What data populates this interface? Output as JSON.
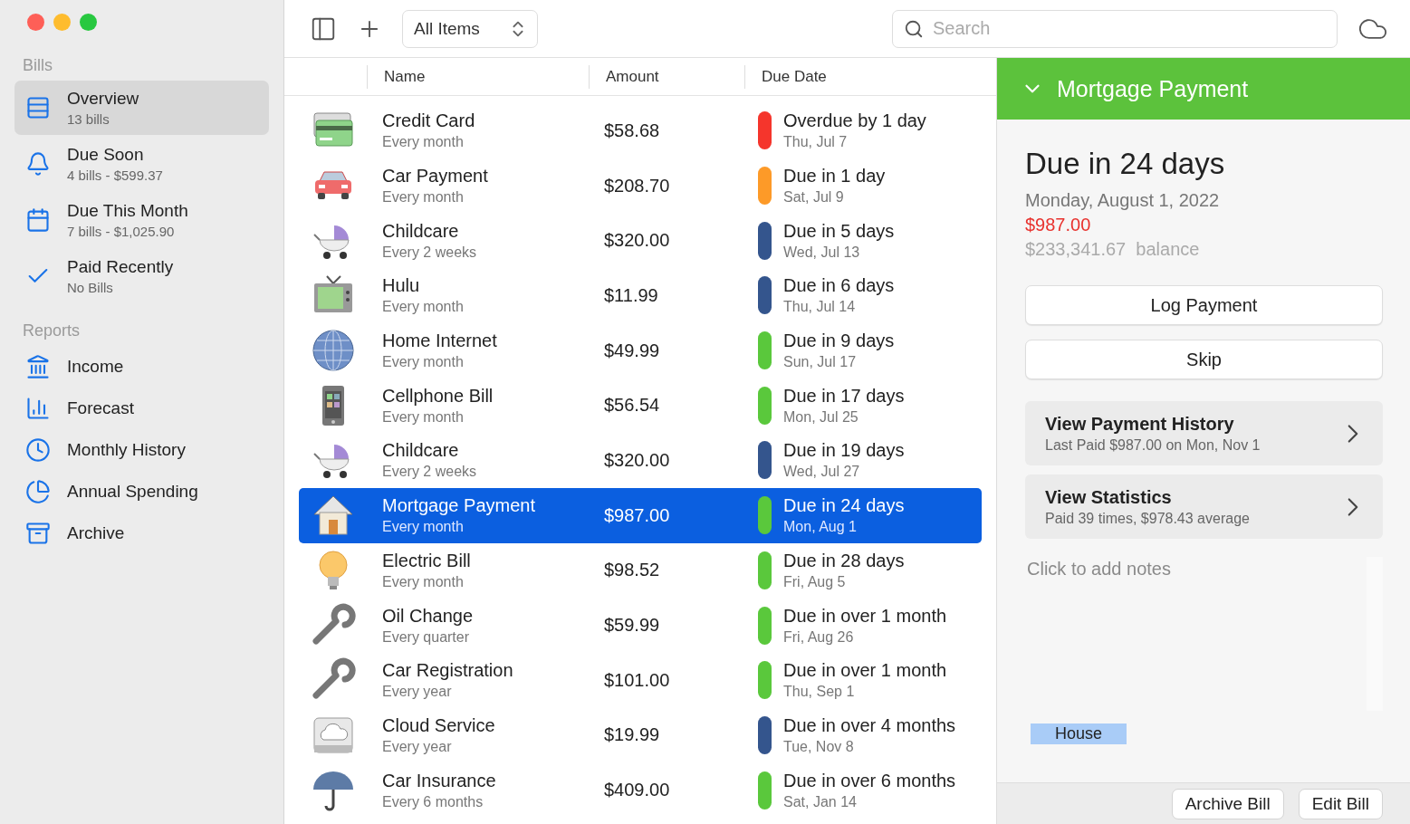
{
  "sidebar": {
    "sections": [
      {
        "title": "Bills",
        "items": [
          {
            "label": "Overview",
            "detail": "13 bills",
            "kind": "list",
            "selected": true
          },
          {
            "label": "Due Soon",
            "detail": "4 bills - $599.37",
            "kind": "bell",
            "selected": false
          },
          {
            "label": "Due This Month",
            "detail": "7 bills - $1,025.90",
            "kind": "calendar",
            "selected": false
          },
          {
            "label": "Paid Recently",
            "detail": "No Bills",
            "kind": "check",
            "selected": false
          }
        ]
      },
      {
        "title": "Reports",
        "items": [
          {
            "label": "Income",
            "kind": "bank",
            "selected": false
          },
          {
            "label": "Forecast",
            "kind": "chart",
            "selected": false
          },
          {
            "label": "Monthly History",
            "kind": "clock",
            "selected": false
          },
          {
            "label": "Annual Spending",
            "kind": "pie",
            "selected": false
          },
          {
            "label": "Archive",
            "kind": "archive",
            "selected": false
          }
        ]
      }
    ]
  },
  "toolbar": {
    "filter": "All Items",
    "search": {
      "placeholder": "Search"
    }
  },
  "table": {
    "columns": [
      "Name",
      "Amount",
      "Due Date"
    ],
    "rows": [
      {
        "name": "Credit Card",
        "frequency": "Every month",
        "amount": "$58.68",
        "due": "Overdue by 1 day",
        "date": "Thu, Jul 7",
        "color": "#f5352c",
        "kind": "card",
        "selected": false
      },
      {
        "name": "Car Payment",
        "frequency": "Every month",
        "amount": "$208.70",
        "due": "Due in 1 day",
        "date": "Sat, Jul 9",
        "color": "#fd9a28",
        "kind": "car",
        "selected": false
      },
      {
        "name": "Childcare",
        "frequency": "Every 2 weeks",
        "amount": "$320.00",
        "due": "Due in 5 days",
        "date": "Wed, Jul 13",
        "color": "#34558d",
        "kind": "stroller",
        "selected": false
      },
      {
        "name": "Hulu",
        "frequency": "Every month",
        "amount": "$11.99",
        "due": "Due in 6 days",
        "date": "Thu, Jul 14",
        "color": "#34558d",
        "kind": "tv",
        "selected": false
      },
      {
        "name": "Home Internet",
        "frequency": "Every month",
        "amount": "$49.99",
        "due": "Due in 9 days",
        "date": "Sun, Jul 17",
        "color": "#5ac83c",
        "kind": "globe",
        "selected": false
      },
      {
        "name": "Cellphone Bill",
        "frequency": "Every month",
        "amount": "$56.54",
        "due": "Due in 17 days",
        "date": "Mon, Jul 25",
        "color": "#5ac83c",
        "kind": "phone",
        "selected": false
      },
      {
        "name": "Childcare",
        "frequency": "Every 2 weeks",
        "amount": "$320.00",
        "due": "Due in 19 days",
        "date": "Wed, Jul 27",
        "color": "#34558d",
        "kind": "stroller",
        "selected": false
      },
      {
        "name": "Mortgage Payment",
        "frequency": "Every month",
        "amount": "$987.00",
        "due": "Due in 24 days",
        "date": "Mon, Aug 1",
        "color": "#5ac83c",
        "kind": "house",
        "selected": true
      },
      {
        "name": "Electric Bill",
        "frequency": "Every month",
        "amount": "$98.52",
        "due": "Due in 28 days",
        "date": "Fri, Aug 5",
        "color": "#5ac83c",
        "kind": "bulb",
        "selected": false
      },
      {
        "name": "Oil Change",
        "frequency": "Every quarter",
        "amount": "$59.99",
        "due": "Due in over 1 month",
        "date": "Fri, Aug 26",
        "color": "#5ac83c",
        "kind": "wrench",
        "selected": false
      },
      {
        "name": "Car Registration",
        "frequency": "Every year",
        "amount": "$101.00",
        "due": "Due in over 1 month",
        "date": "Thu, Sep 1",
        "color": "#5ac83c",
        "kind": "wrench",
        "selected": false
      },
      {
        "name": "Cloud Service",
        "frequency": "Every year",
        "amount": "$19.99",
        "due": "Due in over 4 months",
        "date": "Tue, Nov 8",
        "color": "#34558d",
        "kind": "cloud",
        "selected": false
      },
      {
        "name": "Car Insurance",
        "frequency": "Every 6 months",
        "amount": "$409.00",
        "due": "Due in over 6 months",
        "date": "Sat, Jan 14",
        "color": "#5ac83c",
        "kind": "umbrella",
        "selected": false
      }
    ]
  },
  "detail": {
    "title": "Mortgage Payment",
    "due": "Due in 24 days",
    "date": "Monday, August 1, 2022",
    "amount": "$987.00",
    "balance": "$233,341.67  balance",
    "buttons": [
      "Log Payment",
      "Skip"
    ],
    "links": [
      {
        "title": "View Payment History",
        "detail": "Last Paid $987.00 on Mon, Nov 1"
      },
      {
        "title": "View Statistics",
        "detail": "Paid 39 times, $978.43 average"
      }
    ],
    "notes": {
      "placeholder": "Click to add notes"
    },
    "tag": "House",
    "footer_buttons": [
      "Archive Bill",
      "Edit Bill"
    ]
  }
}
